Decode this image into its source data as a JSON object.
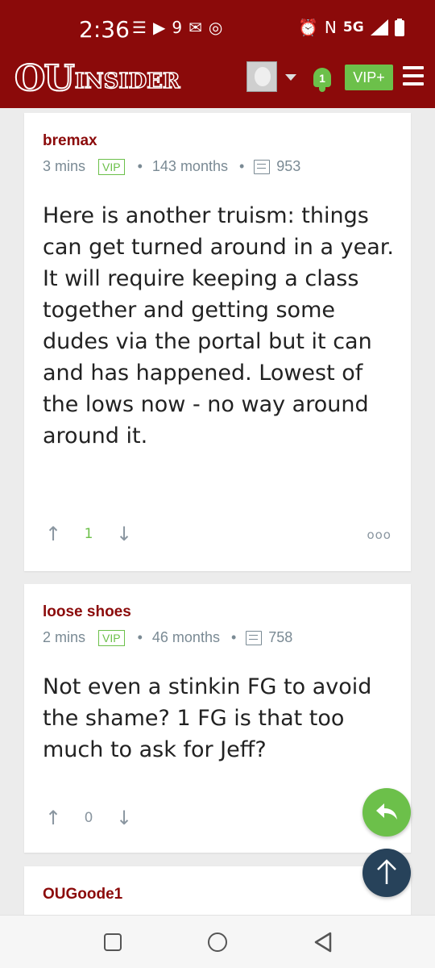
{
  "status_bar": {
    "time": "2:36",
    "left_icons": [
      "☰",
      "▶",
      "9",
      "✉",
      "◎"
    ],
    "right_icons": [
      "⏰",
      "N"
    ],
    "network": "5G",
    "signal_icon": "signal-icon",
    "battery_icon": "battery-icon"
  },
  "header": {
    "logo_ou": "OU",
    "logo_insider": "INSIDER",
    "notification_count": "1",
    "vip_label": "VIP+",
    "colors": {
      "brand": "#8b0a0a",
      "accent": "#6cc04a"
    }
  },
  "posts": [
    {
      "author": "bremax",
      "time_ago": "3 mins",
      "badge": "VIP",
      "tenure": "143 months",
      "post_count": "953",
      "body": "Here is another truism: things can get turned around in a year. It will require keeping a class together and getting some dudes via the portal but it can and has happened. Lowest of the lows now - no way around around it.",
      "vote_count": "1",
      "more_label": "ooo"
    },
    {
      "author": "loose shoes",
      "time_ago": "2 mins",
      "badge": "VIP",
      "tenure": "46 months",
      "post_count": "758",
      "body": "Not even a stinkin FG to avoid the shame? 1 FG is that too much to ask for Jeff?",
      "vote_count": "0"
    },
    {
      "author": "OUGoode1"
    }
  ],
  "fab": {
    "reply_icon": "reply-icon",
    "top_icon": "arrow-up-icon"
  }
}
